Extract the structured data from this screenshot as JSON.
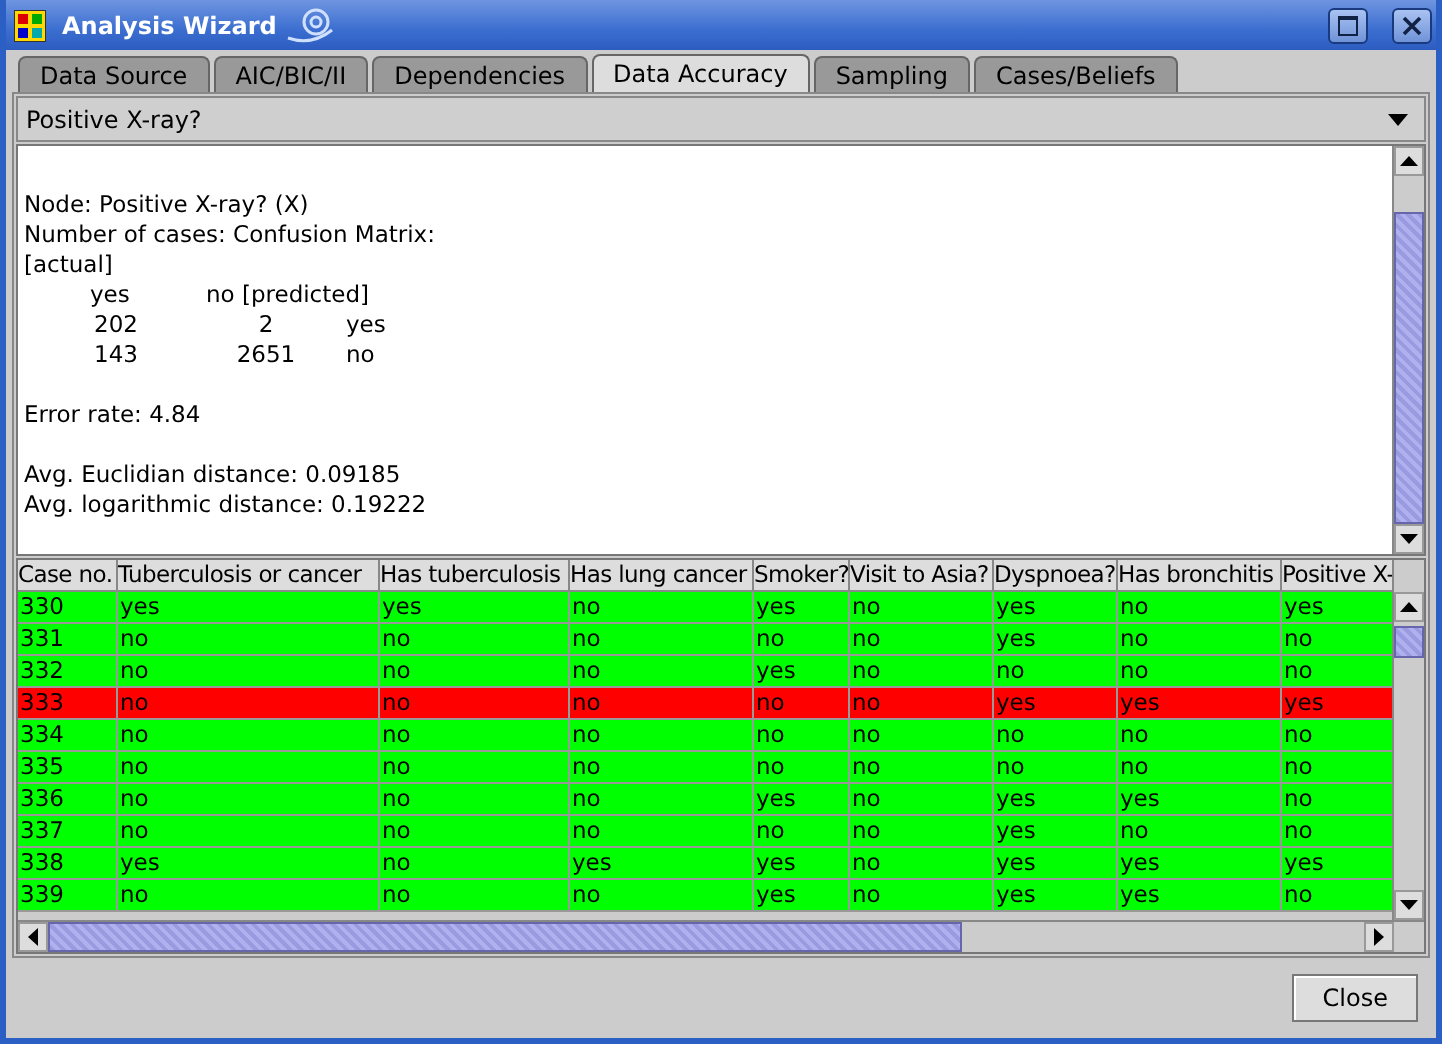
{
  "window": {
    "title": "Analysis Wizard"
  },
  "tabs": [
    {
      "label": "Data Source",
      "selected": false
    },
    {
      "label": "AIC/BIC/II",
      "selected": false
    },
    {
      "label": "Dependencies",
      "selected": false
    },
    {
      "label": "Data Accuracy",
      "selected": true
    },
    {
      "label": "Sampling",
      "selected": false
    },
    {
      "label": "Cases/Beliefs",
      "selected": false
    }
  ],
  "node_dropdown": {
    "value": "Positive X-ray?"
  },
  "report": {
    "header_lines": [
      "Node: Positive X-ray? (X)",
      "Number of cases: Confusion Matrix:",
      "[actual]"
    ],
    "matrix": {
      "columns": [
        "yes",
        "no [predicted]"
      ],
      "rows": [
        {
          "cells": [
            "202",
            "2"
          ],
          "label": "yes"
        },
        {
          "cells": [
            "143",
            "2651"
          ],
          "label": "no"
        }
      ]
    },
    "error_rate": "Error rate: 4.84",
    "distances": [
      "Avg. Euclidian distance: 0.09185",
      "Avg. logarithmic distance: 0.19222"
    ]
  },
  "table": {
    "columns": [
      "Case no.",
      "Tuberculosis or cancer",
      "Has tuberculosis",
      "Has lung cancer",
      "Smoker?",
      "Visit to Asia?",
      "Dyspnoea?",
      "Has bronchitis",
      "Positive X-"
    ],
    "rows": [
      {
        "misclassified": false,
        "cells": [
          "330",
          "yes",
          "yes",
          "no",
          "yes",
          "no",
          "yes",
          "no",
          "yes"
        ]
      },
      {
        "misclassified": false,
        "cells": [
          "331",
          "no",
          "no",
          "no",
          "no",
          "no",
          "yes",
          "no",
          "no"
        ]
      },
      {
        "misclassified": false,
        "cells": [
          "332",
          "no",
          "no",
          "no",
          "yes",
          "no",
          "no",
          "no",
          "no"
        ]
      },
      {
        "misclassified": true,
        "cells": [
          "333",
          "no",
          "no",
          "no",
          "no",
          "no",
          "yes",
          "yes",
          "yes"
        ]
      },
      {
        "misclassified": false,
        "cells": [
          "334",
          "no",
          "no",
          "no",
          "no",
          "no",
          "no",
          "no",
          "no"
        ]
      },
      {
        "misclassified": false,
        "cells": [
          "335",
          "no",
          "no",
          "no",
          "no",
          "no",
          "no",
          "no",
          "no"
        ]
      },
      {
        "misclassified": false,
        "cells": [
          "336",
          "no",
          "no",
          "no",
          "yes",
          "no",
          "yes",
          "yes",
          "no"
        ]
      },
      {
        "misclassified": false,
        "cells": [
          "337",
          "no",
          "no",
          "no",
          "no",
          "no",
          "yes",
          "no",
          "no"
        ]
      },
      {
        "misclassified": false,
        "cells": [
          "338",
          "yes",
          "no",
          "yes",
          "yes",
          "no",
          "yes",
          "yes",
          "yes"
        ]
      },
      {
        "misclassified": false,
        "cells": [
          "339",
          "no",
          "no",
          "no",
          "yes",
          "no",
          "yes",
          "yes",
          "no"
        ]
      }
    ]
  },
  "buttons": [
    "Close"
  ]
}
